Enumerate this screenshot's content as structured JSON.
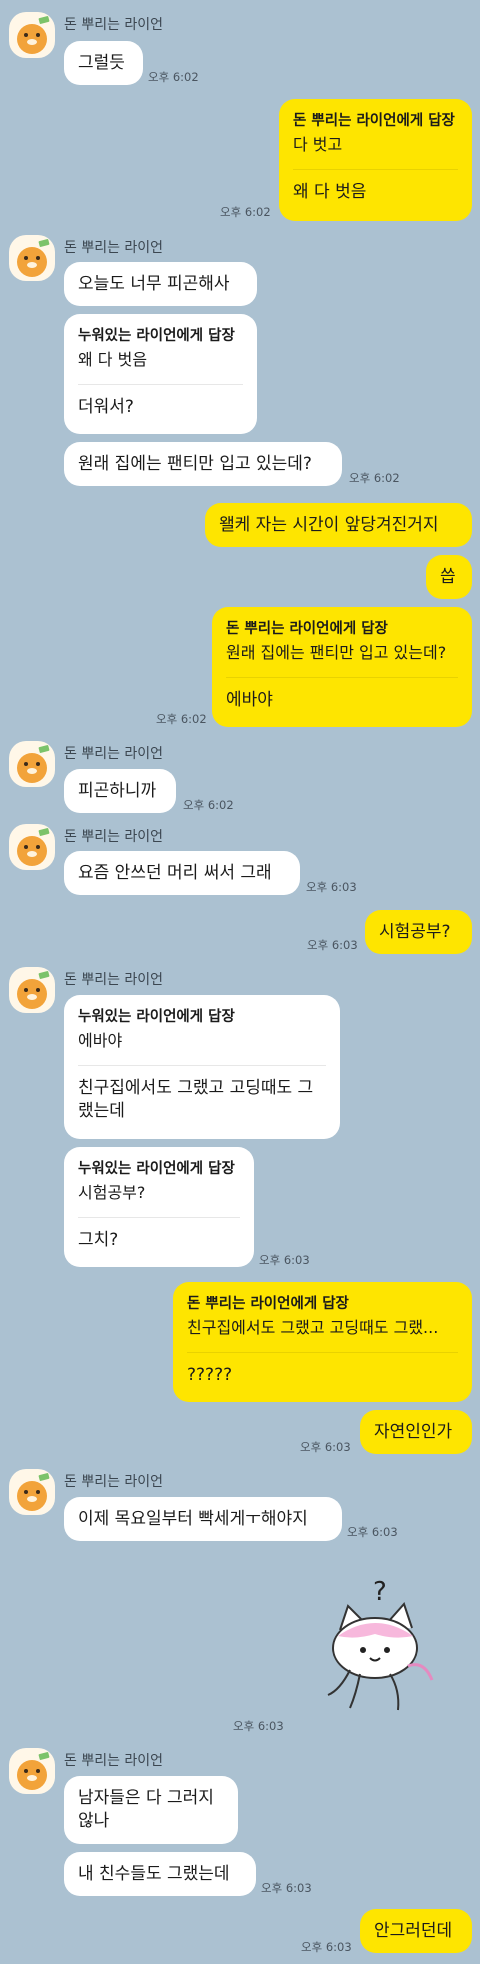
{
  "sender": "돈 뿌리는 라이언",
  "messages": {
    "m1": {
      "text": "그럴듯",
      "time": "오후 6:02"
    },
    "m2": {
      "title": "돈 뿌리는 라이언에게 답장",
      "quote": "다 벗고",
      "text": "왜 다 벗음",
      "time": "오후 6:02"
    },
    "m3": {
      "text": "오늘도 너무 피곤해사"
    },
    "m4": {
      "title": "누워있는 라이언에게 답장",
      "quote": "왜 다 벗음",
      "text": "더워서?"
    },
    "m5": {
      "text": "원래 집에는 팬티만 입고 있는데?",
      "time": "오후 6:02"
    },
    "m6": {
      "text": "왤케 자는 시간이 앞당겨진거지"
    },
    "m7": {
      "text": "씁"
    },
    "m8": {
      "title": "돈 뿌리는 라이언에게 답장",
      "quote": "원래 집에는 팬티만 입고 있는데?",
      "text": "에바야",
      "time": "오후 6:02"
    },
    "m9": {
      "text": "피곤하니까",
      "time": "오후 6:02"
    },
    "m10": {
      "text": "요즘 안쓰던 머리 써서 그래",
      "time": "오후 6:03"
    },
    "m11": {
      "text": "시험공부?",
      "time": "오후 6:03"
    },
    "m12": {
      "title": "누워있는 라이언에게 답장",
      "quote": "에바야",
      "text": "친구집에서도 그랬고 고딩때도 그랬는데"
    },
    "m13": {
      "title": "누워있는 라이언에게 답장",
      "quote": "시험공부?",
      "text": "그치?",
      "time": "오후 6:03"
    },
    "m14": {
      "title": "돈 뿌리는 라이언에게 답장",
      "quote": "친구집에서도 그랬고 고딩때도 그랬...",
      "text": "?????"
    },
    "m15": {
      "text": "자연인인가",
      "time": "오후 6:03"
    },
    "m16": {
      "text": "이제 목요일부터 빡세게ㅜ해야지",
      "time": "오후 6:03"
    },
    "m17": {
      "sticker": "cat-question-sticker",
      "time": "오후 6:03"
    },
    "m18": {
      "text": "남자들은 다 그러지 않나"
    },
    "m19": {
      "text": "내 친수들도 그랬는데",
      "time": "오후 6:03"
    },
    "m20": {
      "text": "안그러던데",
      "time": "오후 6:03"
    }
  },
  "colors": {
    "background": "#abc1d1",
    "mine": "#fee500",
    "theirs": "#ffffff"
  }
}
